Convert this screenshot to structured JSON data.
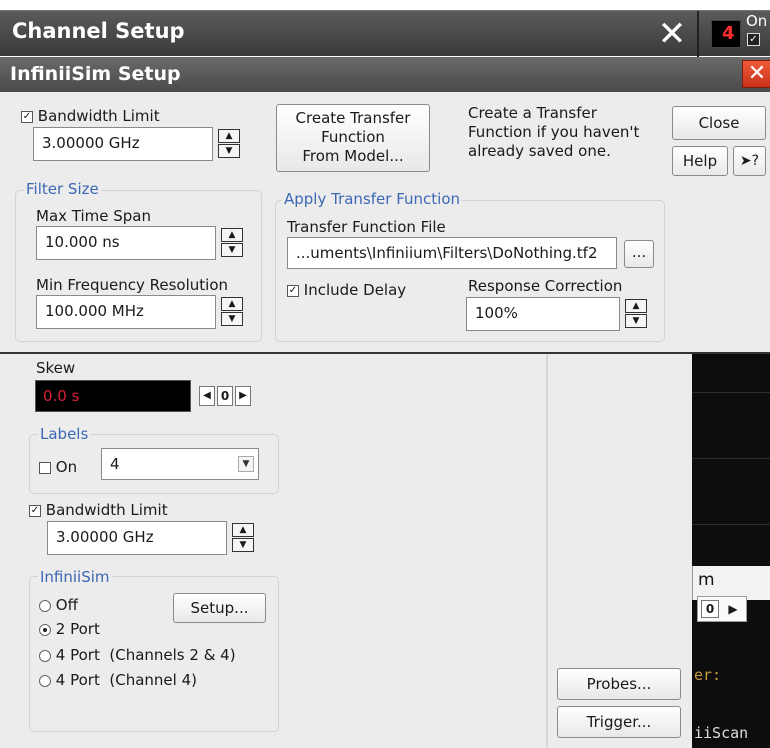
{
  "channel_window": {
    "title": "Channel Setup",
    "close_glyph": "✕",
    "channel_badge": "4",
    "on_label": "On",
    "on_checked": true,
    "skew": {
      "label": "Skew",
      "value": "0.0 s",
      "step_value": "0"
    },
    "labels_group": {
      "title": "Labels",
      "on_label": "On",
      "on_checked": false,
      "selected": "4"
    },
    "bandwidth_limit": {
      "label": "Bandwidth Limit",
      "checked": true,
      "value": "3.00000 GHz"
    },
    "infiniisim_group": {
      "title": "InfiniiSim",
      "options": [
        {
          "label": "Off",
          "selected": false
        },
        {
          "label": "2 Port",
          "selected": true
        },
        {
          "label": "4 Port  (Channels 2 & 4)",
          "selected": false
        },
        {
          "label": "4 Port  (Channel 4)",
          "selected": false
        }
      ],
      "setup_button": "Setup..."
    },
    "probes_button": "Probes...",
    "trigger_button": "Trigger..."
  },
  "background_scope": {
    "tab_fragment": "m",
    "step_value": "0",
    "text_fragment_1": "er:",
    "text_fragment_2": "iiScan"
  },
  "infiniisim_dialog": {
    "title": "InfiniiSim Setup",
    "close_glyph": "✕",
    "bandwidth_limit": {
      "label": "Bandwidth Limit",
      "checked": true,
      "value": "3.00000 GHz"
    },
    "create_transfer_button": [
      "Create Transfer",
      "Function",
      "From Model..."
    ],
    "create_hint": [
      "Create a Transfer",
      "Function if you haven't",
      "already saved one."
    ],
    "close_button": "Close",
    "help_button": "Help",
    "whats_this_glyph": "?",
    "filter_size": {
      "title": "Filter Size",
      "max_time_span_label": "Max Time Span",
      "max_time_span_value": "10.000 ns",
      "min_freq_label": "Min Frequency Resolution",
      "min_freq_value": "100.000 MHz"
    },
    "apply_transfer": {
      "title": "Apply Transfer Function",
      "file_label": "Transfer Function File",
      "file_value": "...uments\\Infiniium\\Filters\\DoNothing.tf2",
      "browse_button": "...",
      "include_delay_label": "Include Delay",
      "include_delay_checked": true,
      "response_correction_label": "Response Correction",
      "response_correction_value": "100%"
    }
  },
  "colors": {
    "title_bar": "#4a4a4a",
    "dialog_bg": "#ececec",
    "group_label": "#3d68b5",
    "skew_text": "#d81e3a",
    "badge_text": "#ff2d2d",
    "close_red": "#d8401f"
  }
}
